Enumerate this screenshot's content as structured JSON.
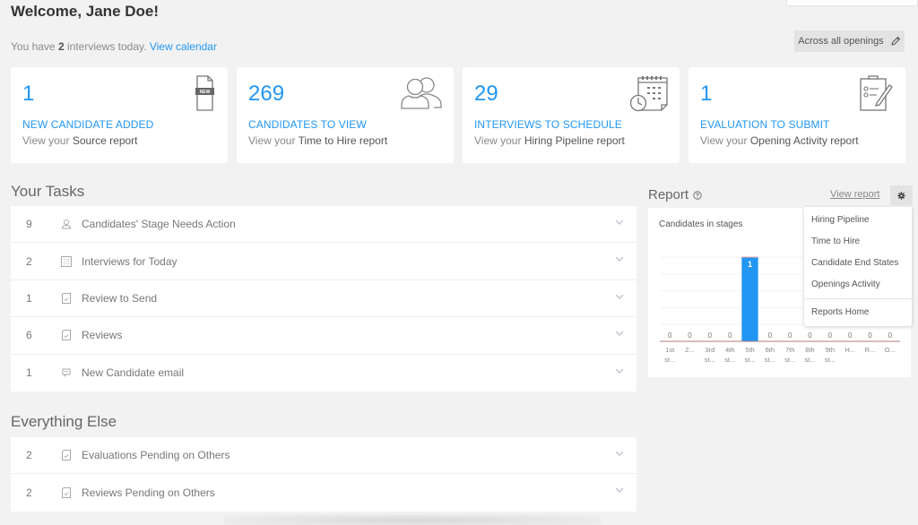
{
  "header": {
    "welcome": "Welcome, Jane Doe!",
    "interviews_prefix": "You have ",
    "interviews_count": "2",
    "interviews_suffix": " interviews today.",
    "view_calendar": "View calendar",
    "filter_label": "Across all openings"
  },
  "cards": [
    {
      "number": "1",
      "title": "NEW CANDIDATE ADDED",
      "sub_prefix": "View your ",
      "sub_link": "Source report",
      "icon": "new-document-icon"
    },
    {
      "number": "269",
      "title": "CANDIDATES TO VIEW",
      "sub_prefix": "View your ",
      "sub_link": "Time to Hire report",
      "icon": "users-icon"
    },
    {
      "number": "29",
      "title": "INTERVIEWS TO SCHEDULE",
      "sub_prefix": "View your ",
      "sub_link": "Hiring Pipeline report",
      "icon": "calendar-clock-icon"
    },
    {
      "number": "1",
      "title": "EVALUATION TO SUBMIT",
      "sub_prefix": "View your ",
      "sub_link": "Opening Activity report",
      "icon": "clipboard-pencil-icon"
    }
  ],
  "your_tasks": {
    "title": "Your Tasks",
    "items": [
      {
        "count": "9",
        "label": "Candidates' Stage Needs Action",
        "icon": "person-icon"
      },
      {
        "count": "2",
        "label": "Interviews for Today",
        "icon": "calendar-icon"
      },
      {
        "count": "1",
        "label": "Review to Send",
        "icon": "review-doc-icon"
      },
      {
        "count": "6",
        "label": "Reviews",
        "icon": "review-doc-icon"
      },
      {
        "count": "1",
        "label": "New Candidate email",
        "icon": "email-icon"
      }
    ]
  },
  "everything_else": {
    "title": "Everything Else",
    "items": [
      {
        "count": "2",
        "label": "Evaluations Pending on Others",
        "icon": "review-doc-icon"
      },
      {
        "count": "2",
        "label": "Reviews Pending on Others",
        "icon": "review-doc-icon"
      }
    ]
  },
  "report": {
    "title": "Report",
    "view_report": "View report",
    "menu": [
      "Hiring Pipeline",
      "Time to Hire",
      "Candidate End States",
      "Openings Activity"
    ],
    "menu_footer": "Reports Home"
  },
  "chart_data": {
    "type": "bar",
    "title": "Candidates in stages",
    "categories": [
      [
        "1st",
        "st..."
      ],
      [
        "2...",
        ""
      ],
      [
        "3rd",
        "st..."
      ],
      [
        "4th",
        "st..."
      ],
      [
        "5th",
        "st..."
      ],
      [
        "6th",
        "st..."
      ],
      [
        "7th",
        "st..."
      ],
      [
        "8th",
        "st..."
      ],
      [
        "9th",
        "st..."
      ],
      [
        "H...",
        ""
      ],
      [
        "R...",
        ""
      ],
      [
        "O...",
        ""
      ]
    ],
    "values": [
      0,
      0,
      0,
      0,
      1,
      0,
      0,
      0,
      0,
      0,
      0,
      0
    ],
    "ylim": [
      0,
      1
    ],
    "bar_color": "#2196f3",
    "grid": true,
    "xlabel": "",
    "ylabel": ""
  }
}
